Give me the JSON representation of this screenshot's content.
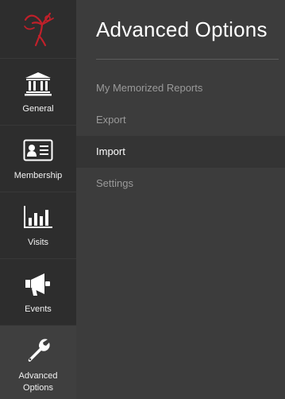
{
  "brand": {
    "logo_icon": "figure-logo-icon",
    "accent_color": "#c0202a"
  },
  "sidebar": {
    "items": [
      {
        "label": "General",
        "icon": "bank-icon",
        "active": false
      },
      {
        "label": "Membership",
        "icon": "id-card-icon",
        "active": false
      },
      {
        "label": "Visits",
        "icon": "bar-chart-icon",
        "active": false
      },
      {
        "label": "Events",
        "icon": "megaphone-icon",
        "active": false
      },
      {
        "label": "Advanced Options",
        "icon": "wrench-icon",
        "active": true
      }
    ]
  },
  "panel": {
    "title": "Advanced Options",
    "menu": [
      {
        "label": "My Memorized Reports",
        "selected": false
      },
      {
        "label": "Export",
        "selected": false
      },
      {
        "label": "Import",
        "selected": true
      },
      {
        "label": "Settings",
        "selected": false
      }
    ]
  }
}
